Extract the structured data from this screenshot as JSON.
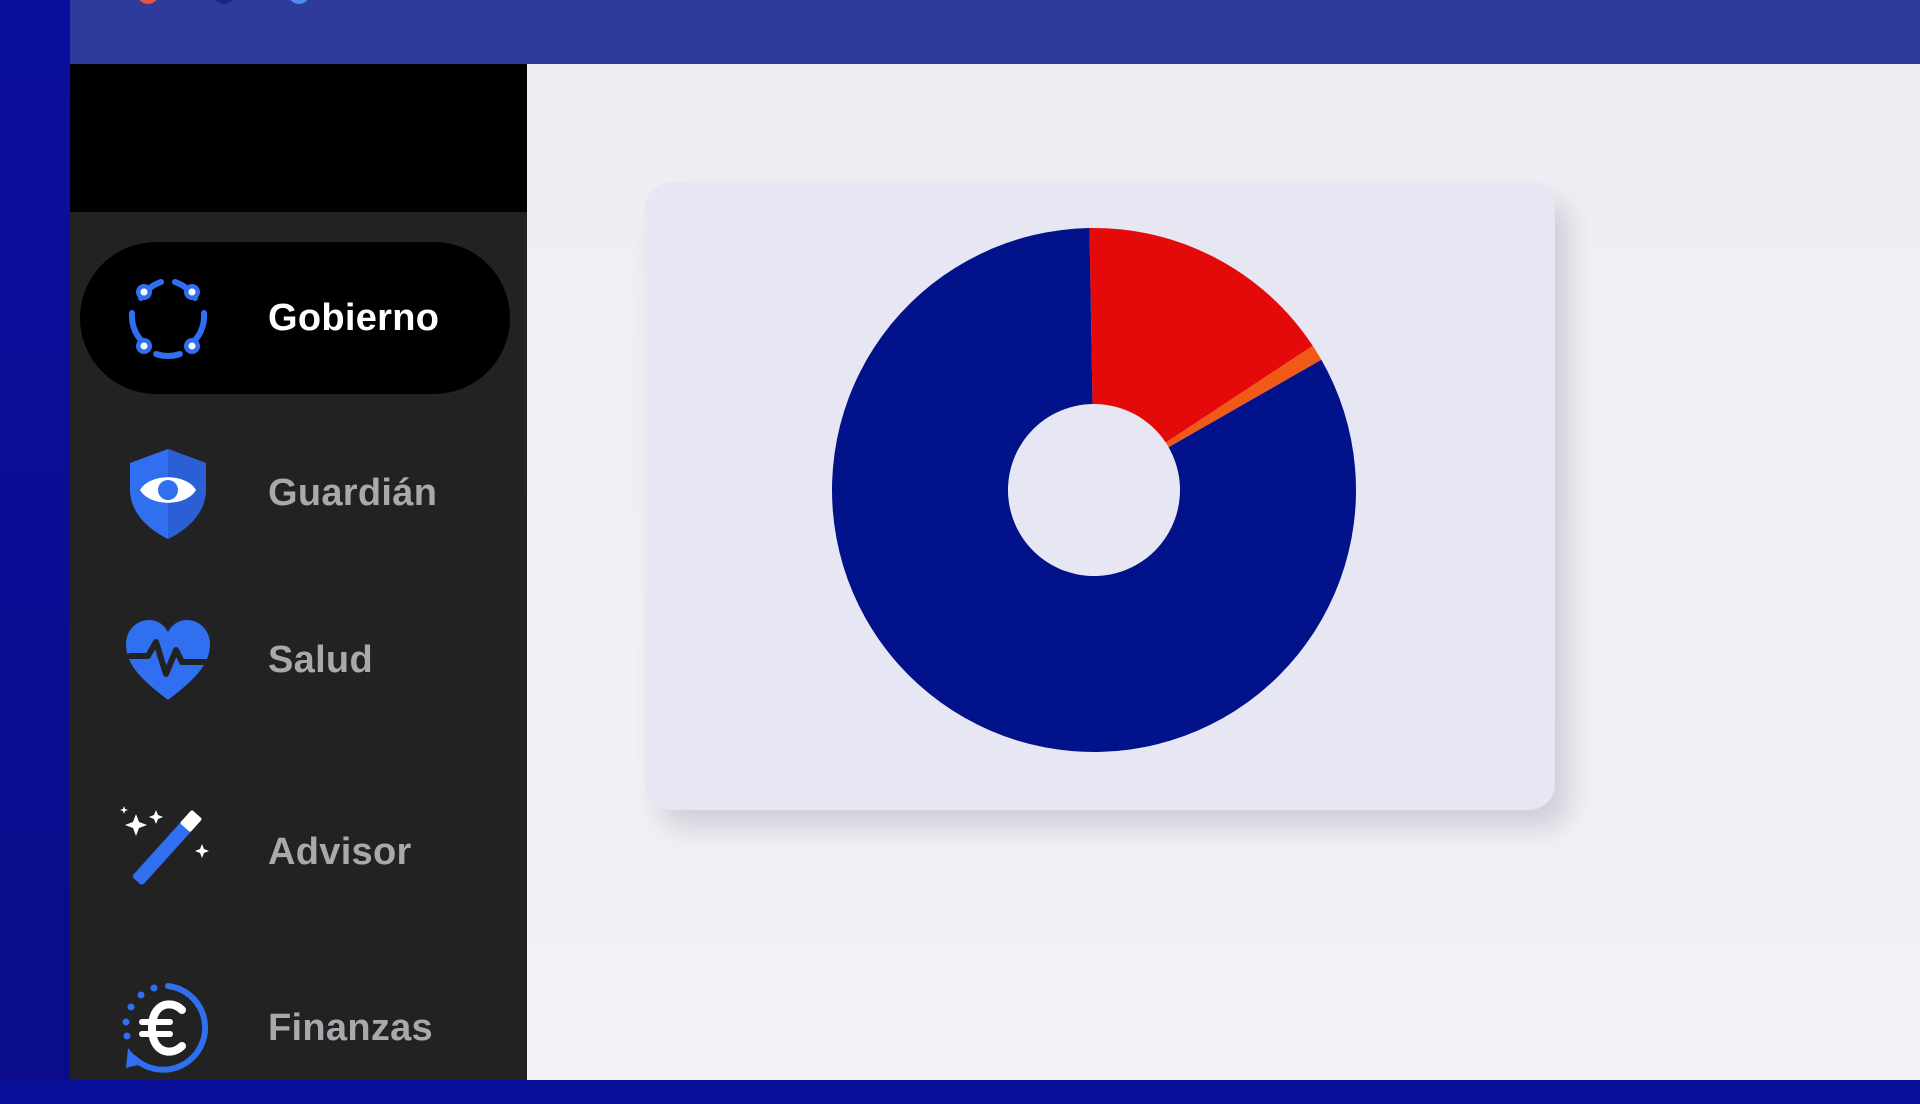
{
  "sidebar": {
    "items": [
      {
        "label": "Gobierno",
        "icon": "network-ring-icon",
        "active": true
      },
      {
        "label": "Guardián",
        "icon": "shield-eye-icon",
        "active": false
      },
      {
        "label": "Salud",
        "icon": "heart-pulse-icon",
        "active": false
      },
      {
        "label": "Advisor",
        "icon": "magic-wand-icon",
        "active": false
      },
      {
        "label": "Finanzas",
        "icon": "euro-cycle-icon",
        "active": false
      }
    ]
  },
  "colors": {
    "accent": "#2563eb",
    "titlebar": "#2e3b9a",
    "sidebar": "#222223",
    "navy": "#02128a",
    "red": "#e40a0a",
    "orange": "#f05a16"
  },
  "chart_data": {
    "type": "pie",
    "donut": true,
    "values": [
      16,
      1,
      83
    ],
    "colors": [
      "#e40a0a",
      "#f05a16",
      "#02128a"
    ]
  }
}
